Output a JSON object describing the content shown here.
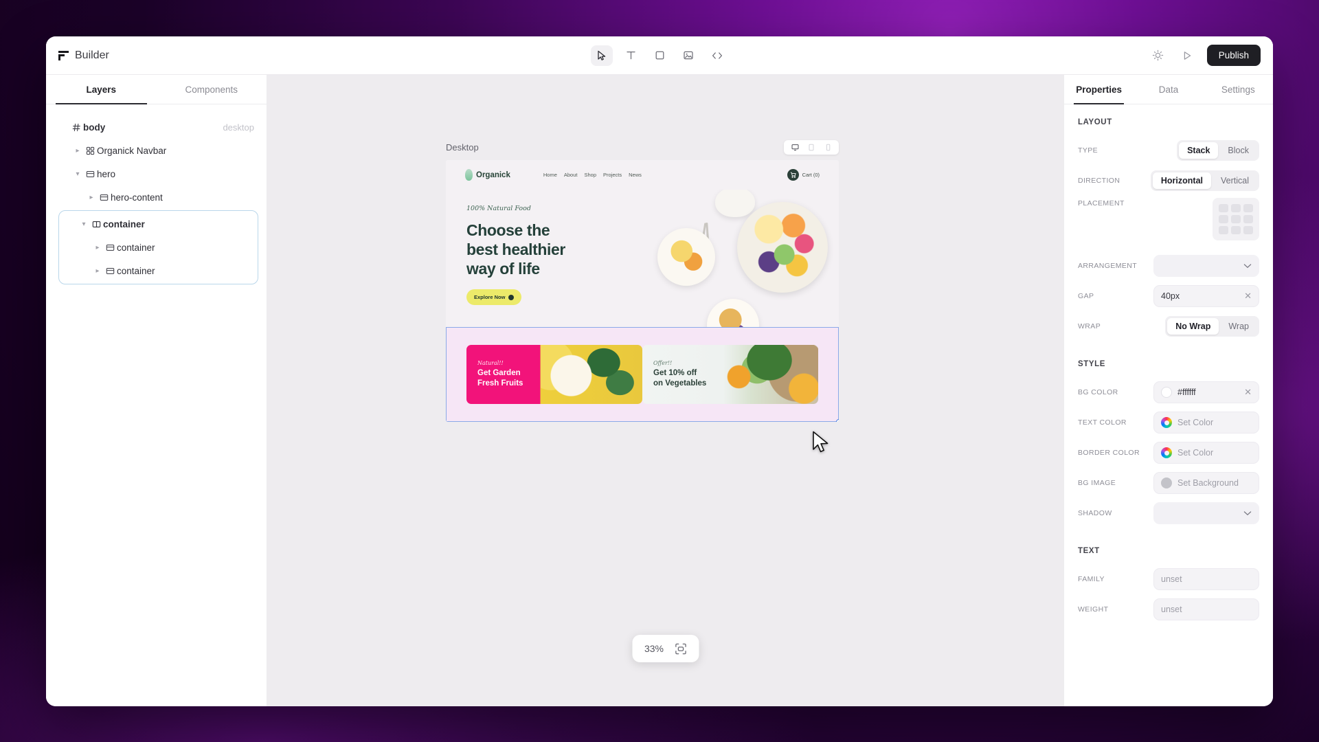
{
  "app": {
    "brand": "Builder",
    "brand_icon": "builder-logo-icon"
  },
  "toolbar": {
    "tools": [
      {
        "name": "select-tool",
        "icon": "cursor-arrow-icon",
        "active": true
      },
      {
        "name": "text-tool",
        "icon": "text-t-icon",
        "active": false
      },
      {
        "name": "rectangle-tool",
        "icon": "square-icon",
        "active": false
      },
      {
        "name": "image-tool",
        "icon": "image-icon",
        "active": false
      },
      {
        "name": "code-tool",
        "icon": "code-brackets-icon",
        "active": false
      }
    ],
    "theme_icon": "sun-icon",
    "preview_icon": "play-triangle-icon",
    "publish_label": "Publish"
  },
  "left_panel": {
    "tabs": [
      {
        "label": "Layers",
        "active": true
      },
      {
        "label": "Components",
        "active": false
      }
    ],
    "tree": [
      {
        "label": "body",
        "glyph": "hash-icon",
        "chevron": "none",
        "indent": 0,
        "bold": true,
        "tag": "desktop"
      },
      {
        "label": "Organick Navbar",
        "glyph": "component-icon",
        "chevron": "collapsed",
        "indent": 1,
        "bold": false,
        "tag": ""
      },
      {
        "label": "hero",
        "glyph": "section-icon",
        "chevron": "expanded",
        "indent": 1,
        "bold": false,
        "tag": ""
      },
      {
        "label": "hero-content",
        "glyph": "section-icon",
        "chevron": "collapsed",
        "indent": 2,
        "bold": false,
        "tag": ""
      }
    ],
    "selected_group": [
      {
        "label": "container",
        "glyph": "columns-icon",
        "chevron": "expanded",
        "indent": 1,
        "bold": true,
        "tag": ""
      },
      {
        "label": "container",
        "glyph": "section-icon",
        "chevron": "collapsed",
        "indent": 2,
        "bold": false,
        "tag": ""
      },
      {
        "label": "container",
        "glyph": "section-icon",
        "chevron": "collapsed",
        "indent": 2,
        "bold": false,
        "tag": ""
      }
    ]
  },
  "canvas": {
    "artboard_label": "Desktop",
    "device_icons": [
      "monitor-icon",
      "tablet-icon",
      "mobile-icon"
    ],
    "zoom_level": "33%",
    "zoom_fit_icon": "fit-to-screen-icon",
    "site": {
      "logo_text": "Organick",
      "nav_links": [
        "Home",
        "About",
        "Shop",
        "Projects",
        "News"
      ],
      "cart_label": "Cart (0)",
      "cart_icon": "shopping-cart-icon",
      "hero": {
        "eyebrow": "100% Natural Food",
        "title_lines": [
          "Choose the",
          "best healthier",
          "way of life"
        ],
        "cta_label": "Explore Now"
      },
      "promos": [
        {
          "eyebrow": "Natural!!",
          "line1": "Get Garden",
          "line2": "Fresh Fruits",
          "theme": "pink"
        },
        {
          "eyebrow": "Offer!!",
          "line1": "Get 10% off",
          "line2": "on Vegetables",
          "theme": "light"
        }
      ]
    }
  },
  "right_panel": {
    "tabs": [
      {
        "label": "Properties",
        "active": true
      },
      {
        "label": "Data",
        "active": false
      },
      {
        "label": "Settings",
        "active": false
      }
    ],
    "layout": {
      "section_title": "LAYOUT",
      "type_label": "TYPE",
      "type_options": [
        "Stack",
        "Block"
      ],
      "type_value": "Stack",
      "direction_label": "DIRECTION",
      "direction_options": [
        "Horizontal",
        "Vertical"
      ],
      "direction_value": "Horizontal",
      "placement_label": "PLACEMENT",
      "arrangement_label": "ARRANGEMENT",
      "arrangement_value": "",
      "gap_label": "GAP",
      "gap_value": "40px",
      "wrap_label": "WRAP",
      "wrap_options": [
        "No Wrap",
        "Wrap"
      ],
      "wrap_value": "No Wrap"
    },
    "style": {
      "section_title": "STYLE",
      "bg_color_label": "BG COLOR",
      "bg_color_value": "#ffffff",
      "text_color_label": "TEXT COLOR",
      "text_color_placeholder": "Set Color",
      "border_color_label": "BORDER COLOR",
      "border_color_placeholder": "Set Color",
      "bg_image_label": "BG IMAGE",
      "bg_image_placeholder": "Set Background",
      "shadow_label": "SHADOW",
      "shadow_value": ""
    },
    "text": {
      "section_title": "TEXT",
      "family_label": "FAMILY",
      "family_placeholder": "unset",
      "weight_label": "WEIGHT",
      "weight_placeholder": "unset"
    }
  },
  "colors": {
    "accent_selection": "#8aa9e8",
    "publish_bg": "#1f1f24",
    "promo_pink": "#f2137a",
    "promo_yellow": "#ecea6a",
    "canvas_bg": "#eeecef",
    "selected_container_bg": "#f6e6f6"
  }
}
